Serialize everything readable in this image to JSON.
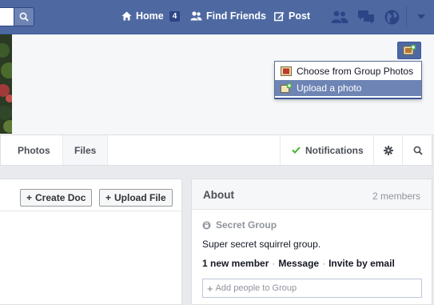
{
  "topbar": {
    "nav": {
      "home_label": "Home",
      "home_count": "4",
      "find_friends_label": "Find Friends",
      "post_label": "Post"
    },
    "icons": [
      "search-icon",
      "home-icon",
      "friends-icon",
      "post-icon",
      "friend-requests-icon",
      "messages-icon",
      "notifications-globe-icon",
      "chevron-down-icon"
    ]
  },
  "cover": {
    "menu": {
      "items": [
        {
          "label": "Choose from Group Photos",
          "icon": "photo-album-icon"
        },
        {
          "label": "Upload a photo",
          "icon": "upload-photo-icon",
          "highlighted": true
        }
      ]
    }
  },
  "tabs": {
    "photos": "Photos",
    "files": "Files",
    "notifications": "Notifications",
    "settings_icon": "gear-icon",
    "search_icon": "search-icon"
  },
  "files_panel": {
    "create_doc": "Create Doc",
    "upload_file": "Upload File"
  },
  "about": {
    "title": "About",
    "member_count": "2 members",
    "privacy": "Secret Group",
    "description": "Super secret squirrel group.",
    "links": {
      "new_member": "1 new member",
      "message": "Message",
      "invite": "Invite by email",
      "separator": "·"
    },
    "add_people_placeholder": "Add people to Group"
  },
  "colors": {
    "topbar": "#4e69a2",
    "topbar_border": "#3b5998",
    "menu_highlight": "#6d84b4",
    "page_bg": "#e9eaed",
    "check_green": "#42b72a"
  }
}
